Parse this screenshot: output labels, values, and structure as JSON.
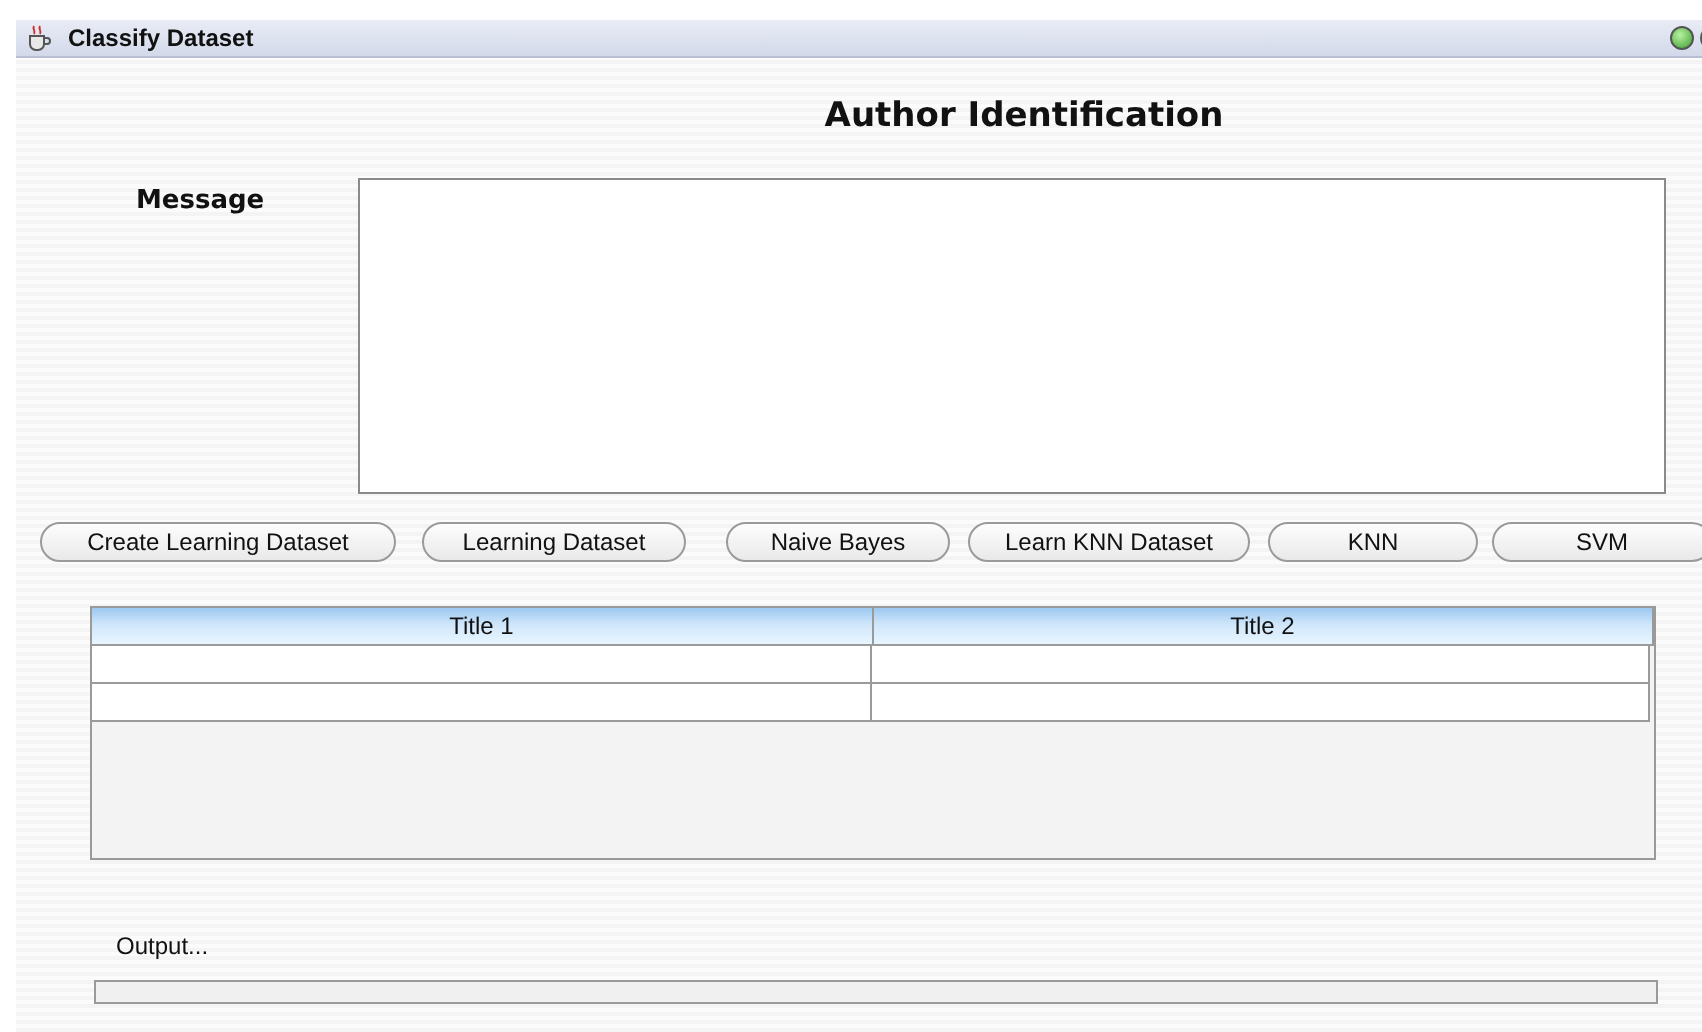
{
  "window": {
    "title": "Classify Dataset"
  },
  "heading": "Author Identification",
  "message": {
    "label": "Message"
  },
  "buttons": [
    "Create Learning Dataset",
    "Learning Dataset",
    "Naive Bayes",
    "Learn KNN Dataset",
    "KNN",
    "SVM"
  ],
  "table": {
    "columns": [
      "Title 1",
      "Title 2"
    ],
    "rows": [
      [
        "",
        ""
      ],
      [
        "",
        ""
      ]
    ]
  },
  "output": {
    "label": "Output..."
  }
}
